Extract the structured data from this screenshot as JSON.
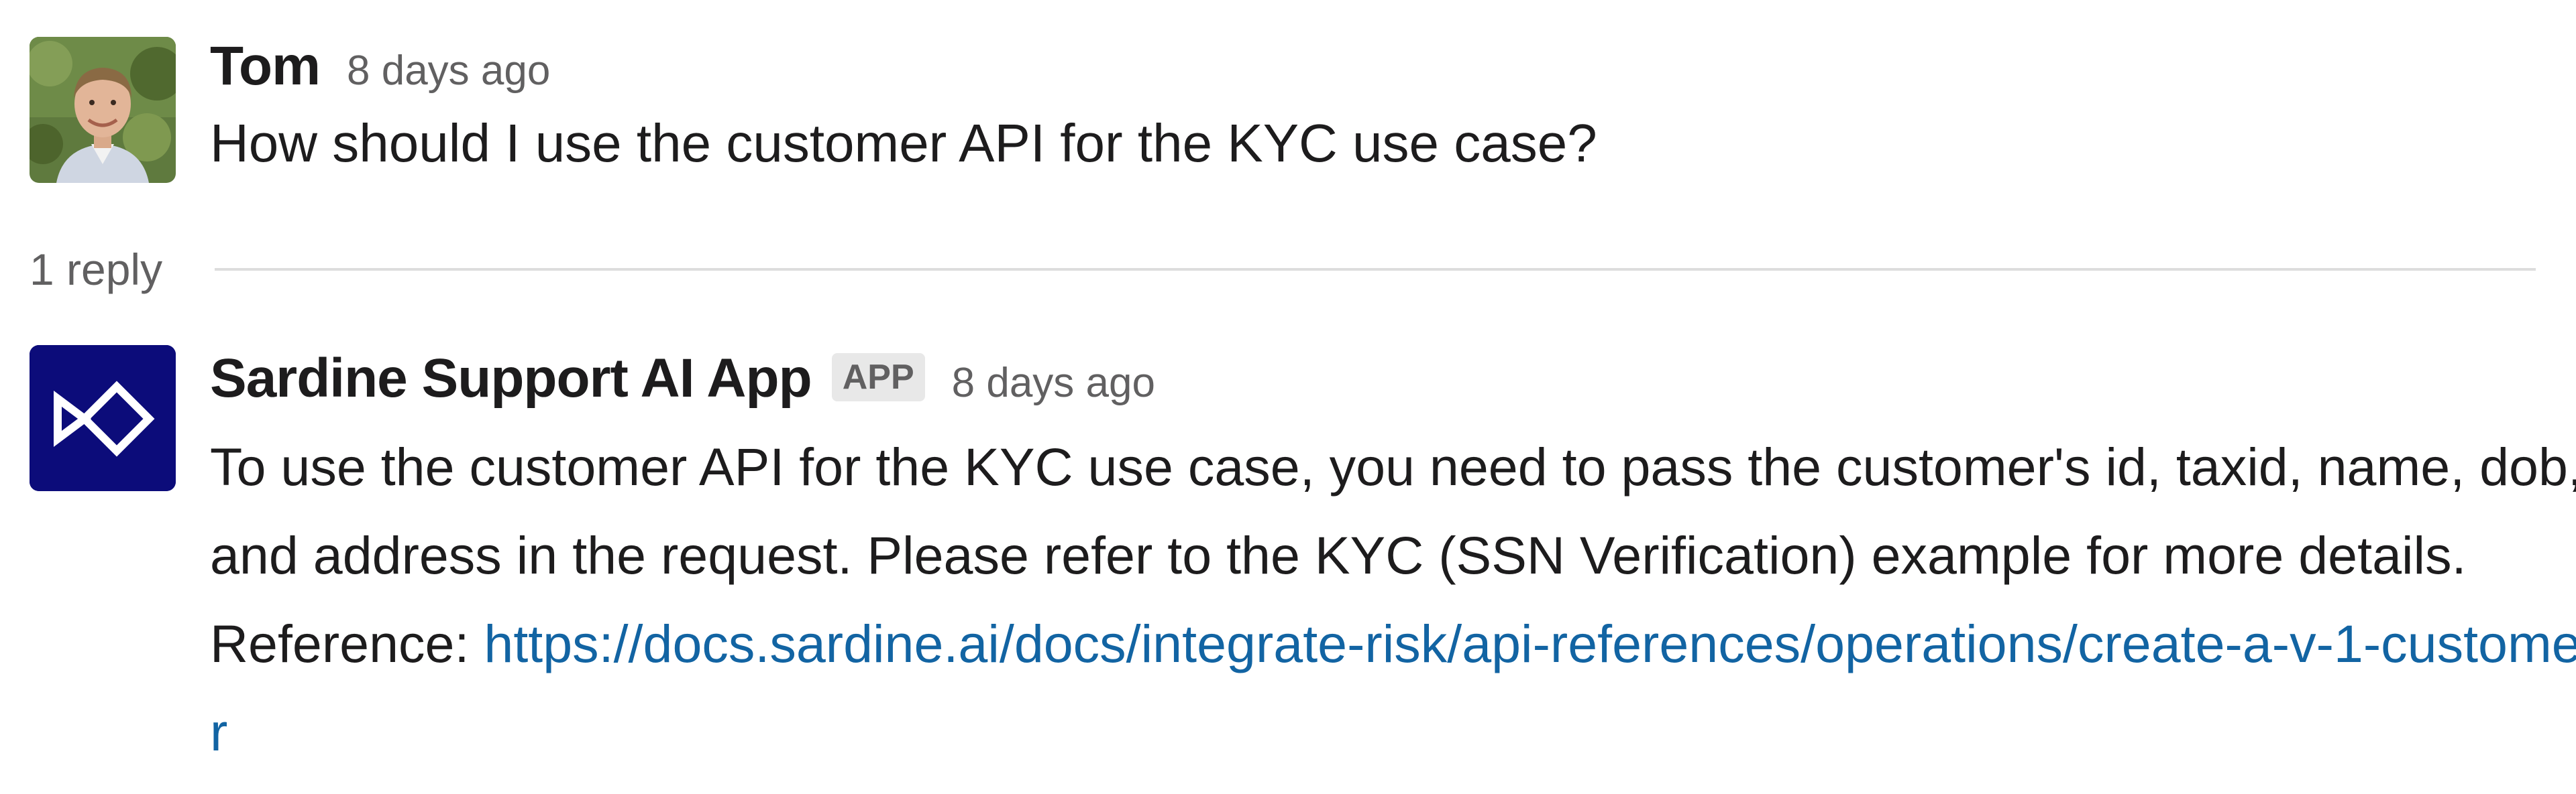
{
  "thread": {
    "question": {
      "author": "Tom",
      "time": "8 days ago",
      "text": "How should I use the customer API for the KYC use case?",
      "avatar_icon": "user-photo-avatar"
    },
    "reply_count_label": "1 reply",
    "reply": {
      "author": "Sardine Support AI App",
      "badge": "APP",
      "time": "8 days ago",
      "text": "To use the customer API for the KYC use case, you need to pass the customer's id, taxid, name, dob, and address in the request. Please refer to the KYC (SSN Verification) example for more details. Reference: ",
      "link": "https://docs.sardine.ai/docs/integrate-risk/api-references/operations/create-a-v-1-customer",
      "avatar_icon": "sardine-logo-icon",
      "avatar_bg": "#0c0c7a"
    }
  },
  "colors": {
    "text": "#1d1c1d",
    "muted": "#616061",
    "link": "#1264a3",
    "divider": "#dddddd",
    "badge_bg": "#e8e8e8"
  }
}
